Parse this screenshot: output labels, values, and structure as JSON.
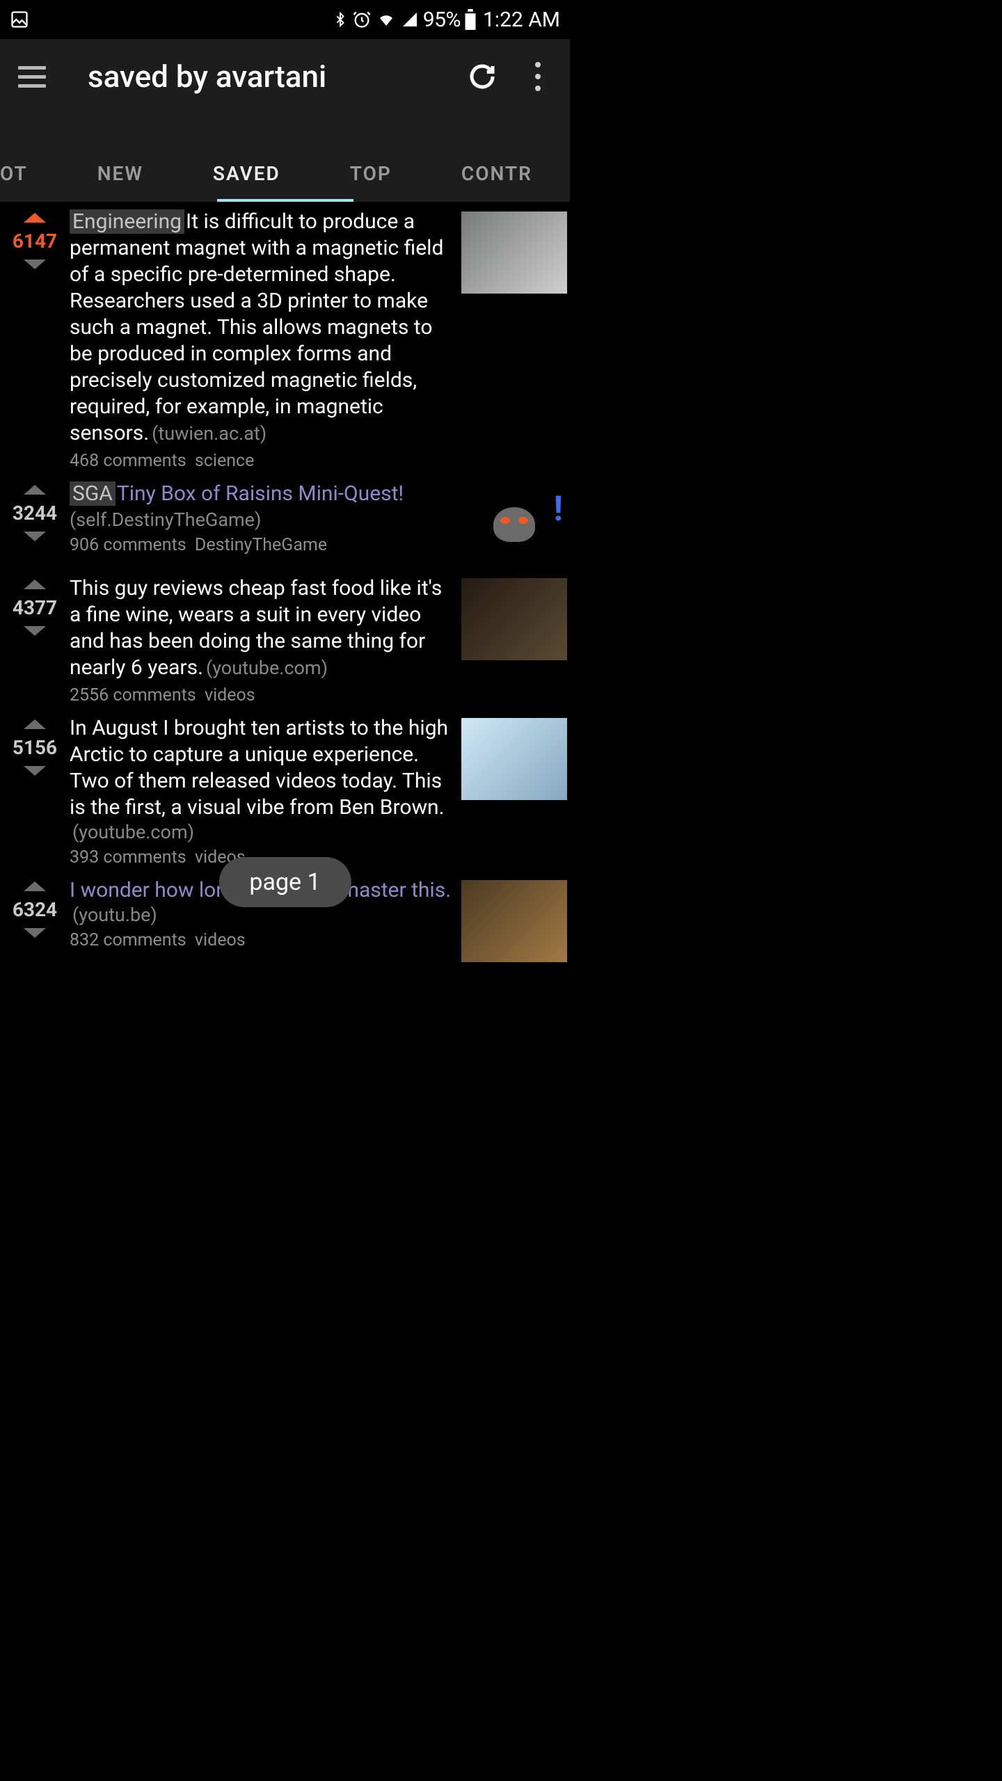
{
  "status": {
    "battery_pct": "95%",
    "time": "1:22 AM"
  },
  "header": {
    "title": "saved by avartani"
  },
  "tabs": {
    "items": [
      "OT",
      "NEW",
      "SAVED",
      "TOP",
      "CONTR"
    ],
    "active_index": 2
  },
  "posts": [
    {
      "score": "6147",
      "upvoted": true,
      "flair": "Engineering",
      "title": "It is difficult to produce a permanent magnet with a magnetic field of a specific pre-determined shape. Researchers used a 3D printer to make such a magnet. This allows magnets to be produced in complex forms and precisely customized magnetic fields, required, for example, in magnetic sensors.",
      "domain": "(tuwien.ac.at)",
      "self_domain": null,
      "comments": "468 comments",
      "subreddit": "science",
      "visited": false,
      "thumb": "t1"
    },
    {
      "score": "3244",
      "upvoted": false,
      "flair": "SGA",
      "title": "Tiny Box of Raisins Mini-Quest!",
      "domain": null,
      "self_domain": "(self.DestinyTheGame)",
      "comments": "906 comments",
      "subreddit": "DestinyTheGame",
      "visited": true,
      "thumb": "t2"
    },
    {
      "score": "4377",
      "upvoted": false,
      "flair": null,
      "title": "This guy reviews cheap fast food like it's a fine wine, wears a suit in every video and has been doing the same thing for nearly 6 years.",
      "domain": "(youtube.com)",
      "self_domain": null,
      "comments": "2556 comments",
      "subreddit": "videos",
      "visited": false,
      "thumb": "t3"
    },
    {
      "score": "5156",
      "upvoted": false,
      "flair": null,
      "title": "In August I brought ten artists to the high Arctic to capture a unique experience. Two of them released videos today. This is the first, a visual vibe from Ben Brown.",
      "domain": "(youtube.com)",
      "self_domain": null,
      "comments": "393 comments",
      "subreddit": "videos",
      "visited": false,
      "thumb": "t4"
    },
    {
      "score": "6324",
      "upvoted": false,
      "flair": null,
      "title": "I wonder how long it takes to master this.",
      "domain": "(youtu.be)",
      "self_domain": null,
      "comments": "832 comments",
      "subreddit": "videos",
      "visited": true,
      "thumb": "t5"
    }
  ],
  "page_pill": "page 1"
}
